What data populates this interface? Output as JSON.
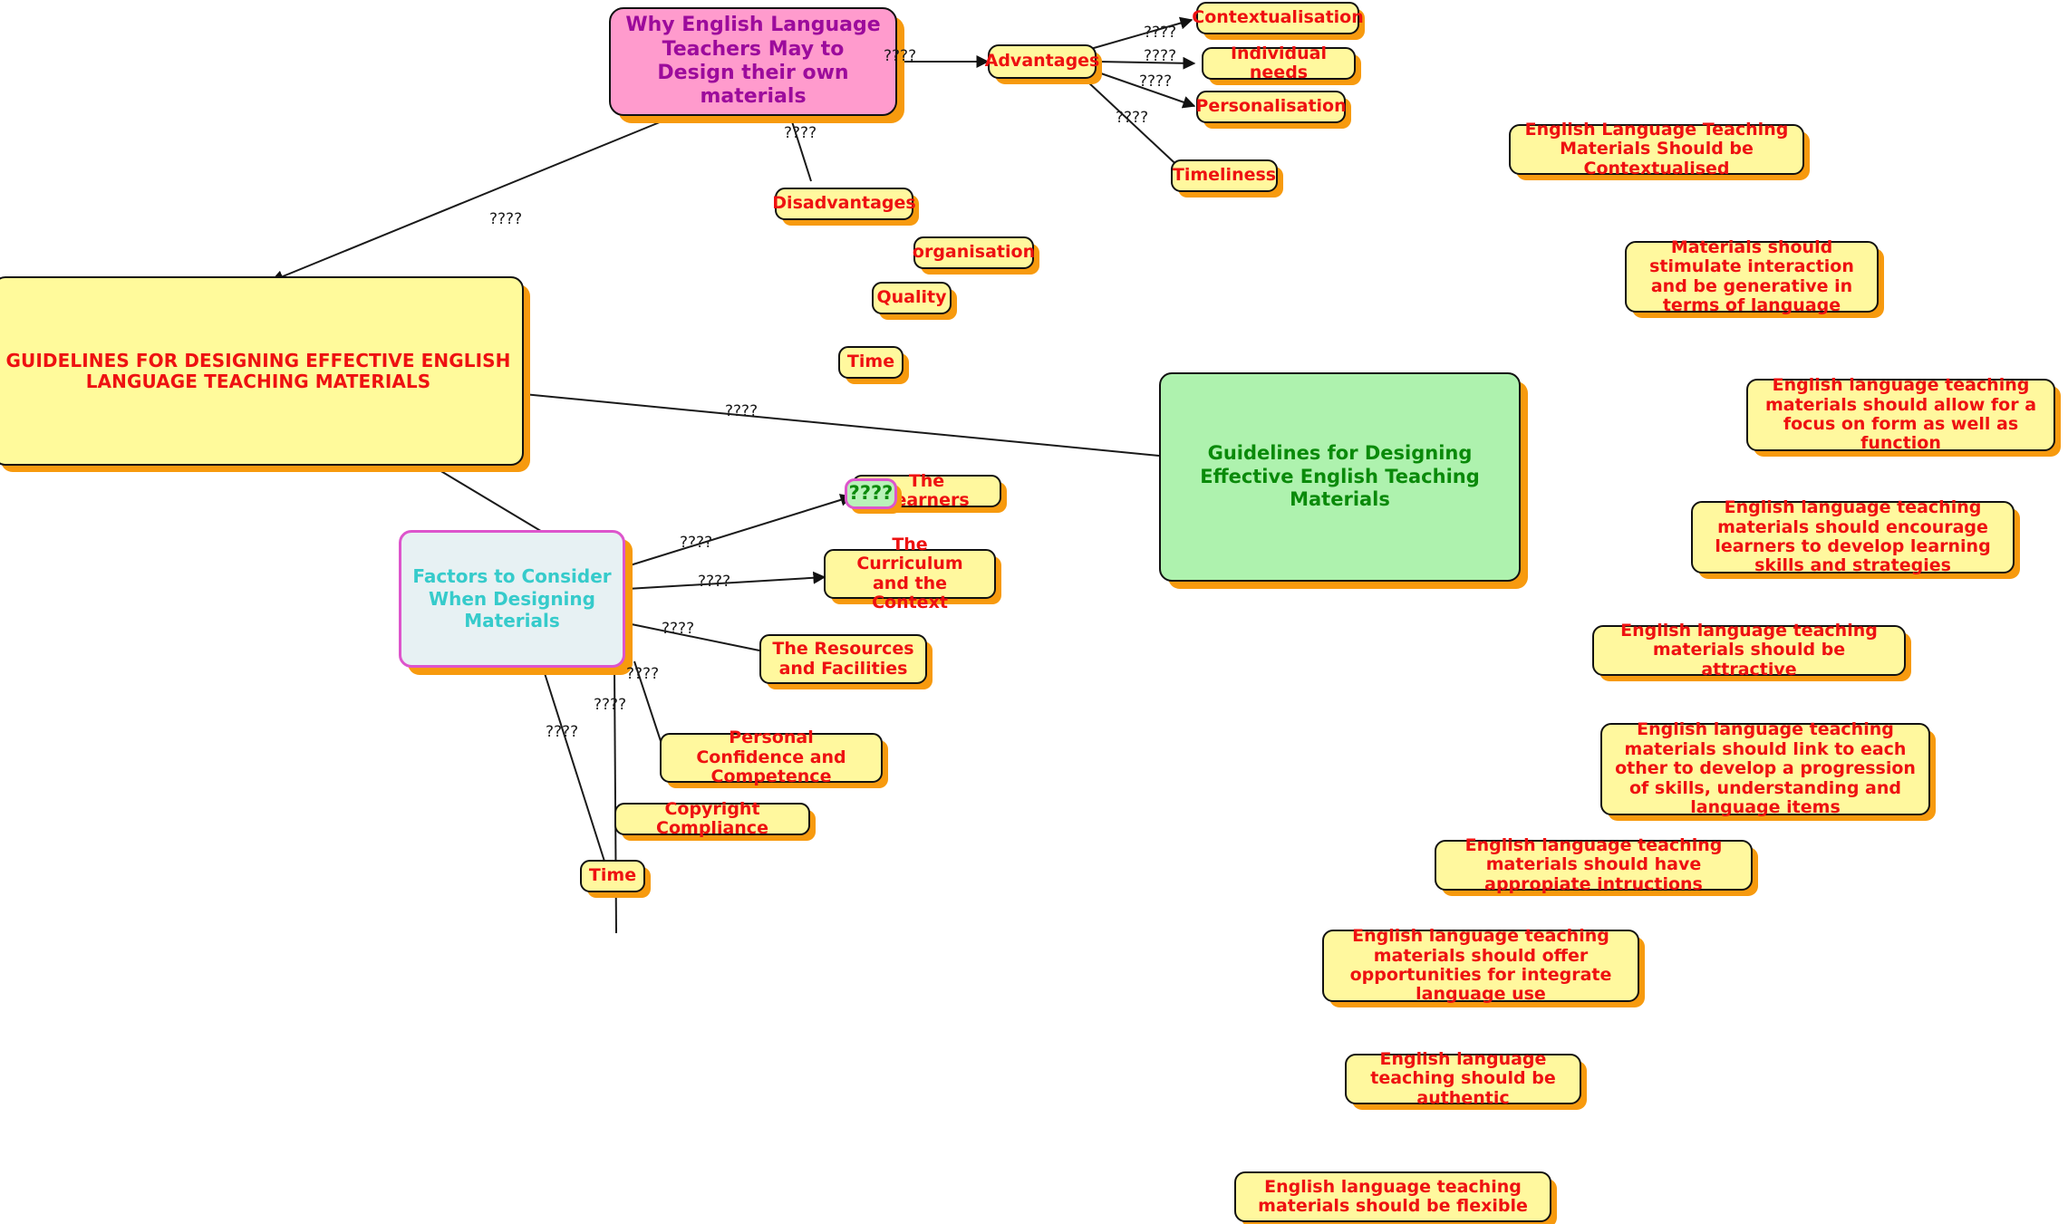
{
  "map": {
    "title": "GUIDELINES FOR DESIGNING EFFECTIVE ENGLISH LANGUAGE TEACHING MATERIALS",
    "background_color": "#FFFFFF",
    "default_node_fill": "#FFF89E",
    "default_node_text": "#EE1111",
    "node_shadow_color": "#F79A0E",
    "edge_color": "#1A1A1A"
  },
  "nodes": {
    "root": {
      "label": "GUIDELINES FOR DESIGNING EFFECTIVE ENGLISH LANGUAGE TEACHING MATERIALS",
      "fill": "#FFFA9B",
      "text_color": "#EE1111"
    },
    "why_teachers": {
      "label": "Why English Language Teachers May to Design their own materials",
      "fill": "#FF9BCD",
      "text_color": "#9C0B9C"
    },
    "advantages": {
      "label": "Advantages"
    },
    "contextualisation": {
      "label": "Contextualisation"
    },
    "individual_needs": {
      "label": "Individual needs"
    },
    "personalisation": {
      "label": "Personalisation"
    },
    "timeliness": {
      "label": "Timeliness"
    },
    "disadvantages": {
      "label": "Disadvantages"
    },
    "organisation": {
      "label": "organisation"
    },
    "quality": {
      "label": "Quality"
    },
    "time_top": {
      "label": "Time"
    },
    "factors": {
      "label": "Factors to Consider When Designing Materials",
      "fill": "#E7F1F3",
      "text_color": "#36CBCB",
      "border_color": "#DD55CC"
    },
    "the_learners": {
      "label": "The Learners"
    },
    "learners_badge": {
      "label": "????",
      "fill": "#B9F2B9",
      "text_color": "#0B8A0B",
      "border_color": "#DD55CC"
    },
    "curriculum_context": {
      "label": "The Curriculum and the Context"
    },
    "resources_facilities": {
      "label": "The Resources and Facilities"
    },
    "personal_confidence": {
      "label": "Personal Confidence and Competence"
    },
    "copyright_compliance": {
      "label": "Copyright Compliance"
    },
    "time_bottom": {
      "label": "Time"
    },
    "guidelines_green": {
      "label": "Guidelines for Designing Effective English Teaching Materials",
      "fill": "#AEF2AE",
      "text_color": "#0A8A0A"
    }
  },
  "guidelines": [
    {
      "id": "g1",
      "label": "English Language Teaching Materials Should be Contextualised"
    },
    {
      "id": "g2",
      "label": "Materials should stimulate interaction and be generative in terms of language"
    },
    {
      "id": "g3",
      "label": "English language teaching materials should allow for a focus on form as well as function"
    },
    {
      "id": "g4",
      "label": "English language teaching materials should encourage learners to develop learning skills and strategies"
    },
    {
      "id": "g5",
      "label": "English language teaching materials should be attractive"
    },
    {
      "id": "g6",
      "label": "English language teaching materials should link to each other to develop a progression of skills, understanding and language items"
    },
    {
      "id": "g7",
      "label": "English language teaching materials should have appropiate intructions"
    },
    {
      "id": "g8",
      "label": "English language teaching materials should offer opportunities for integrate language use"
    },
    {
      "id": "g9",
      "label": "English language teaching should be authentic"
    },
    {
      "id": "g10",
      "label": "English language teaching materials should be flexible"
    }
  ],
  "edge_labels": {
    "why_to_advantages": "????",
    "why_to_disadvantages": "????",
    "why_to_root": "????",
    "adv_contextualisation": "????",
    "adv_individual_needs": "????",
    "adv_personalisation": "????",
    "adv_timeliness": "????",
    "root_to_green": "????",
    "factors_learners": "????",
    "factors_curriculum": "????",
    "factors_resources": "????",
    "factors_personal": "????",
    "factors_copyright": "????",
    "factors_time": "????"
  }
}
